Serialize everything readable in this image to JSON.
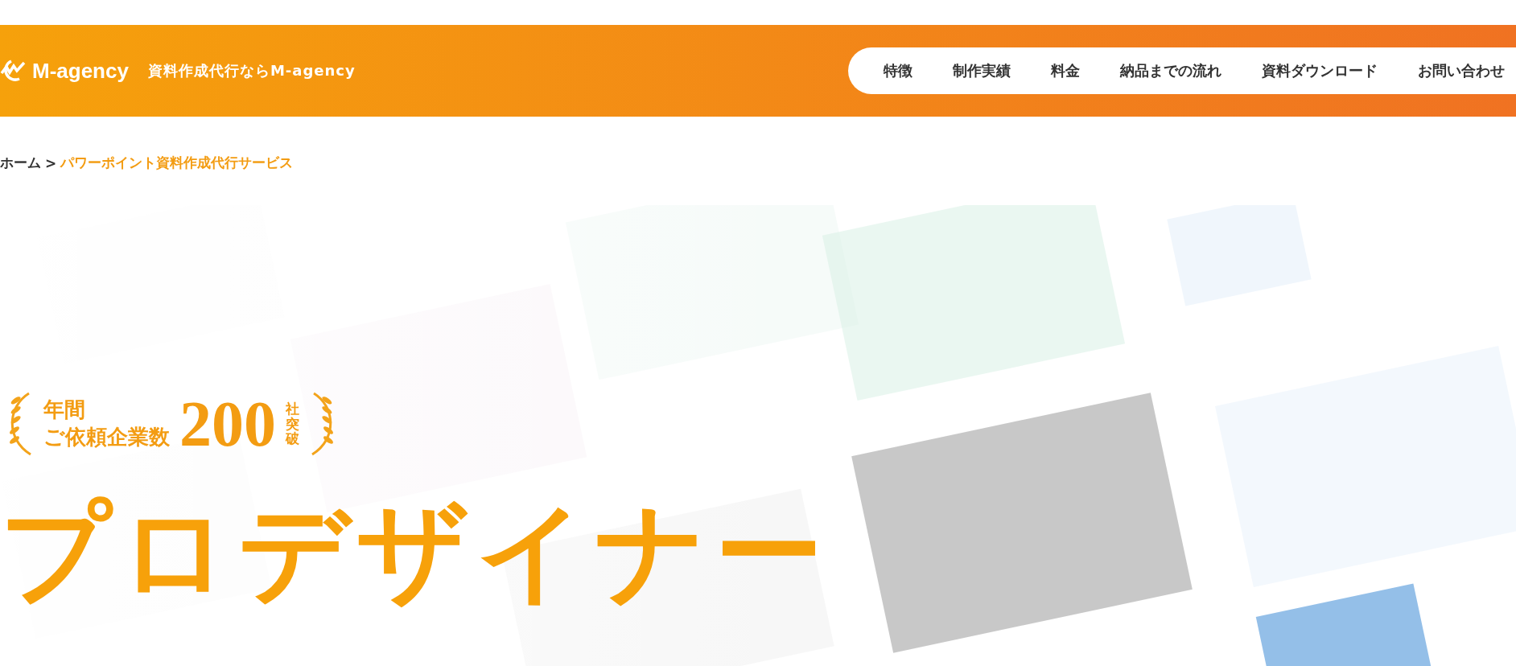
{
  "header": {
    "logo": "M-agency",
    "tagline": "資料作成代行ならM-agency"
  },
  "nav": [
    {
      "label": "特徴"
    },
    {
      "label": "制作実績"
    },
    {
      "label": "料金"
    },
    {
      "label": "納品までの流れ"
    },
    {
      "label": "資料ダウンロード"
    },
    {
      "label": "お問い合わせ"
    }
  ],
  "breadcrumb": {
    "home": "ホーム",
    "separator": ">",
    "current": "パワーポイント資料作成代行サービス"
  },
  "badge": {
    "line_1": "年間",
    "line_2": "ご依頼企業数",
    "number": "200",
    "suffix": "社突破"
  },
  "hero_title": "プロデザイナー"
}
